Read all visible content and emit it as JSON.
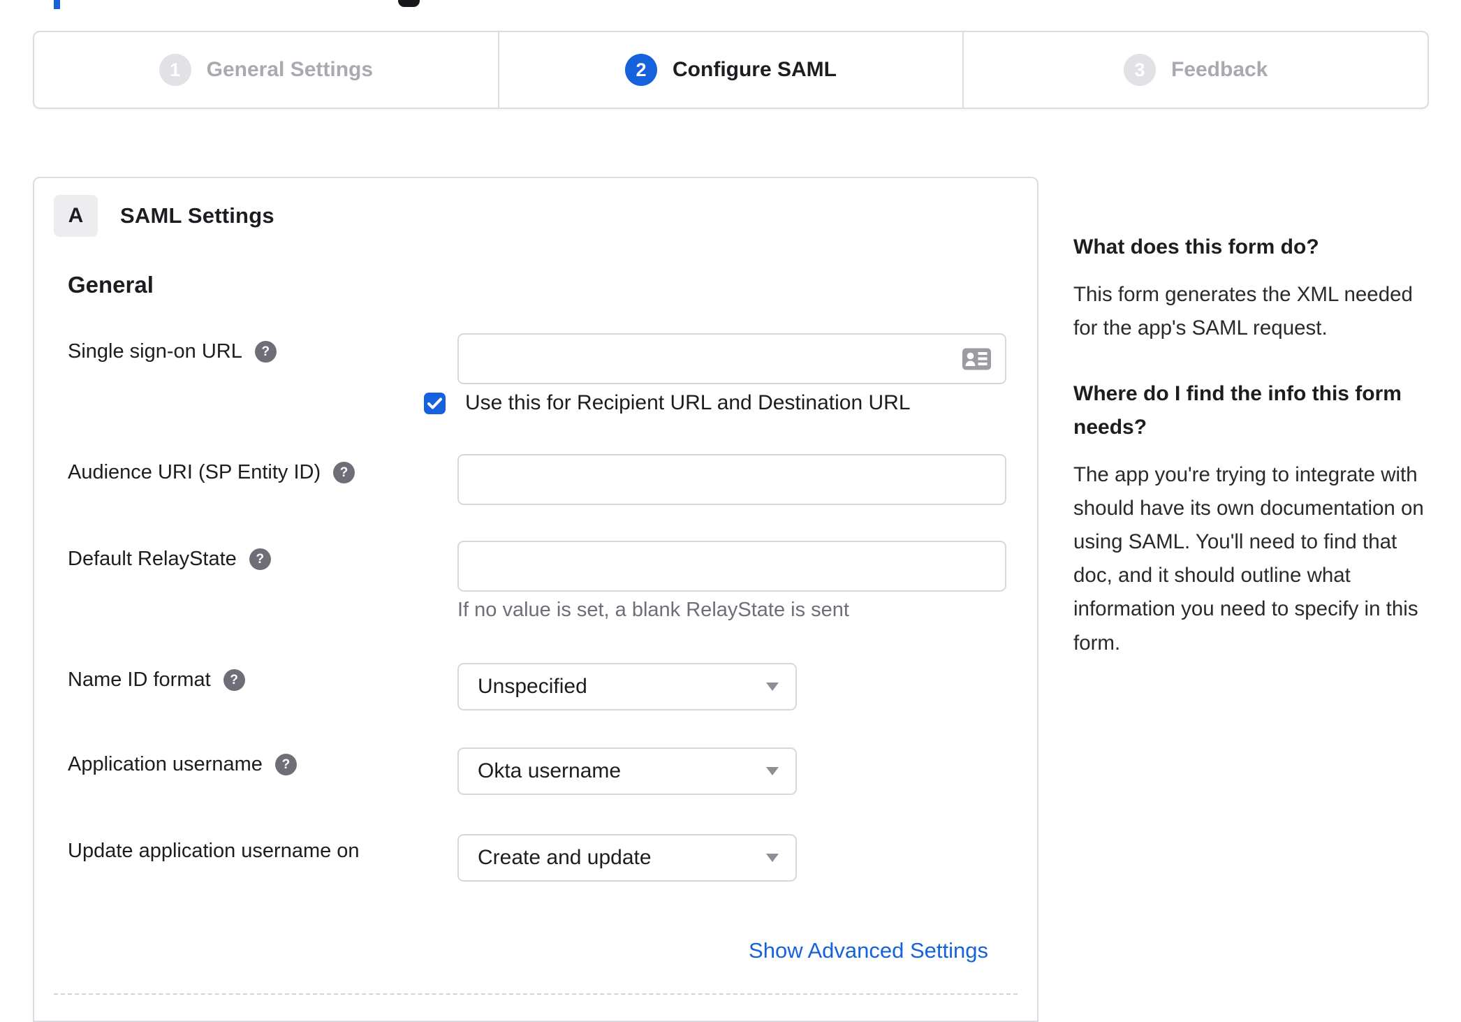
{
  "stepper": {
    "steps": [
      {
        "number": "1",
        "label": "General Settings",
        "state": "inactive"
      },
      {
        "number": "2",
        "label": "Configure SAML",
        "state": "active"
      },
      {
        "number": "3",
        "label": "Feedback",
        "state": "inactive"
      }
    ]
  },
  "panel": {
    "section_badge": "A",
    "section_title": "SAML Settings",
    "subsection_title": "General",
    "show_advanced_label": "Show Advanced Settings"
  },
  "fields": {
    "sso_url": {
      "label": "Single sign-on URL",
      "value": "",
      "checkbox_label": "Use this for Recipient URL and Destination URL",
      "checkbox_checked": true
    },
    "audience_uri": {
      "label": "Audience URI (SP Entity ID)",
      "value": ""
    },
    "relay_state": {
      "label": "Default RelayState",
      "value": "",
      "hint": "If no value is set, a blank RelayState is sent"
    },
    "name_id_format": {
      "label": "Name ID format",
      "value": "Unspecified"
    },
    "app_username": {
      "label": "Application username",
      "value": "Okta username"
    },
    "update_username": {
      "label": "Update application username on",
      "value": "Create and update"
    }
  },
  "sidebar": {
    "q1_heading": "What does this form do?",
    "q1_body": "This form generates the XML needed for the app's SAML request.",
    "q2_heading": "Where do I find the info this form needs?",
    "q2_body": "The app you're trying to integrate with should have its own documentation on using SAML. You'll need to find that doc, and it should outline what information you need to specify in this form."
  },
  "icons": {
    "help": "?",
    "contact_card": "contact-card",
    "chevron_down": "chevron-down",
    "checkmark": "check"
  },
  "colors": {
    "accent_blue": "#1662dd",
    "text_dark": "#1d1d21",
    "text_gray": "#6e6e78",
    "inactive_gray": "#a9a9b1",
    "border_gray": "#d8d8dc"
  }
}
